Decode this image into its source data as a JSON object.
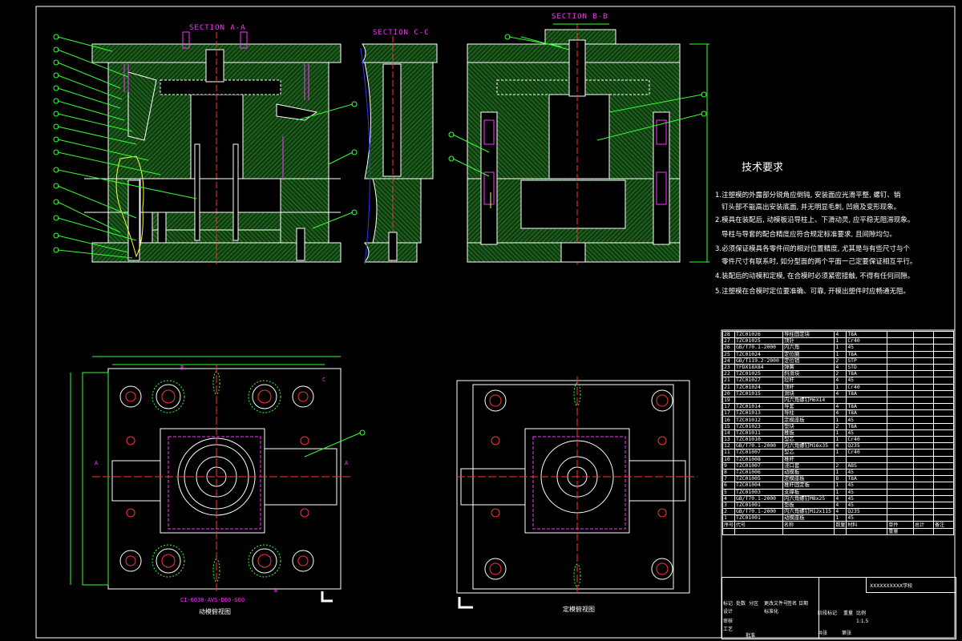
{
  "sections": {
    "aa": "SECTION A-A",
    "cc": "SECTION C-C",
    "bb": "SECTION B-B"
  },
  "tech": {
    "title": "技术要求",
    "lines": [
      "1.注塑模的外露部分锐角应倒钝, 安装面应光滑平整, 螺钉、销",
      "钉头部不能高出安装底面, 并无明显毛刺, 凹痕及变形现象。",
      "2.模具在装配后, 动模板沿导柱上、下滑动灵, 应平稳无阻滞现象。",
      "导柱与导套的配合精度应符合规定标准要求, 且间隙均匀。",
      "3.必须保证模具各零件间的相对位置精度, 尤其是与有些尺寸与个",
      "零件尺寸有联系时, 如分型面的两个平面一己定要保证相互平行。",
      "4.装配后的动模和定模, 在合模时必须紧密接触, 不得有任何间隙。",
      "5.注塑模在合模时定位要准确、可靠, 开模出塑件时应畅通无阻。"
    ]
  },
  "captions": {
    "left_code": "CI-6030-AVS-D00-G00",
    "left_view": "动模俯视图",
    "right_view": "定模俯视图"
  },
  "markers": {
    "a": "A",
    "b": "B",
    "c": "C"
  },
  "bom": {
    "rows": [
      [
        "28",
        "TZC01026",
        "导柱固定块",
        "4",
        "T8A",
        "",
        "",
        ""
      ],
      [
        "27",
        "TZC01025",
        "顶针",
        "1",
        "Cr40",
        "",
        "",
        ""
      ],
      [
        "26",
        "GB/T70.1-2000",
        "内六角",
        "1",
        "45",
        "",
        "",
        ""
      ],
      [
        "25",
        "TZC01024",
        "定位圈",
        "1",
        "T8A",
        "",
        "",
        ""
      ],
      [
        "24",
        "GB/T119.2-2000",
        "定位销",
        "2",
        "STP",
        "",
        "",
        ""
      ],
      [
        "23",
        "TFDX18X84",
        "弹簧",
        "4",
        "STD",
        "",
        "",
        ""
      ],
      [
        "22",
        "TZC01025",
        "斜滑块",
        "2",
        "T8A",
        "",
        "",
        ""
      ],
      [
        "21",
        "TZC01027",
        "拉杆",
        "4",
        "45",
        "",
        "",
        ""
      ],
      [
        "21",
        "TZC01024",
        "顶杆",
        "1",
        "Cr40",
        "",
        "",
        ""
      ],
      [
        "20",
        "TZC01015",
        "滑块",
        "4",
        "T8A",
        "",
        "",
        ""
      ],
      [
        "19",
        "",
        "内六角螺钉M6X14",
        "",
        "",
        "",
        "",
        ""
      ],
      [
        "17",
        "TZC01014",
        "导套",
        "4",
        "T8A",
        "",
        "",
        ""
      ],
      [
        "17",
        "TZC01013",
        "导柱",
        "4",
        "T8A",
        "",
        "",
        ""
      ],
      [
        "16",
        "TZC01012",
        "定模座板",
        "1",
        "45",
        "",
        "",
        ""
      ],
      [
        "15",
        "TZC01023",
        "垫块",
        "2",
        "T8A",
        "",
        "",
        ""
      ],
      [
        "14",
        "TZC01011",
        "推板",
        "1",
        "45",
        "",
        "",
        ""
      ],
      [
        "13",
        "TZC01010",
        "型芯",
        "1",
        "Cr40",
        "",
        "",
        ""
      ],
      [
        "12",
        "GB/T70.1-2000",
        "内六角螺钉M16x35",
        "4",
        "Q235",
        "",
        "",
        ""
      ],
      [
        "11",
        "TZC01007",
        "型芯",
        "1",
        "Cr40",
        "",
        "",
        ""
      ],
      [
        "10",
        "TZC01008",
        "推杆",
        "",
        "",
        "",
        "",
        ""
      ],
      [
        "9",
        "TZC01007",
        "浇口套",
        "2",
        "ABS",
        "",
        "",
        ""
      ],
      [
        "8",
        "TZC01006",
        "动模板",
        "1",
        "45",
        "",
        "",
        ""
      ],
      [
        "7",
        "TZC01005",
        "定模座板",
        "8",
        "T8A",
        "",
        "",
        ""
      ],
      [
        "6",
        "TZC01004",
        "推杆固定板",
        "1",
        "45",
        "",
        "",
        ""
      ],
      [
        "5",
        "TZC01003",
        "支撑板",
        "1",
        "45",
        "",
        "",
        ""
      ],
      [
        "4",
        "GB/T70.1-2000",
        "内六角螺钉M8x25",
        "4",
        "45",
        "",
        "",
        ""
      ],
      [
        "3",
        "TZC01001",
        "垫板",
        "4",
        "45",
        "",
        "",
        ""
      ],
      [
        "2",
        "GB/T70.1-2000",
        "内六角螺钉M12x115",
        "4",
        "Q235",
        "",
        "",
        ""
      ],
      [
        "1",
        "TZC01001",
        "动模座板",
        "1",
        "45",
        "",
        "",
        ""
      ]
    ],
    "header": [
      "序号",
      "代号",
      "名称",
      "数量",
      "材料",
      "单件",
      "总计",
      "备注"
    ],
    "header_extra": "重量"
  },
  "titleblock": {
    "school": "XXXXXXXXXX学校",
    "labels": [
      "标记",
      "处数",
      "分区",
      "更改文件号",
      "签名",
      "日期",
      "设计",
      "标准化",
      "阶段标记",
      "重量",
      "比例",
      "审核",
      "工艺",
      "批准",
      "共张",
      "第张"
    ],
    "scale": "1:1.5"
  },
  "colors": {
    "outline": "#ffffff",
    "green": "#33ff33",
    "magenta": "#ff33ff",
    "red": "#ff3333",
    "yellow": "#ffff33",
    "cyan": "#33ffff",
    "hatch": "#2d7a2d"
  }
}
